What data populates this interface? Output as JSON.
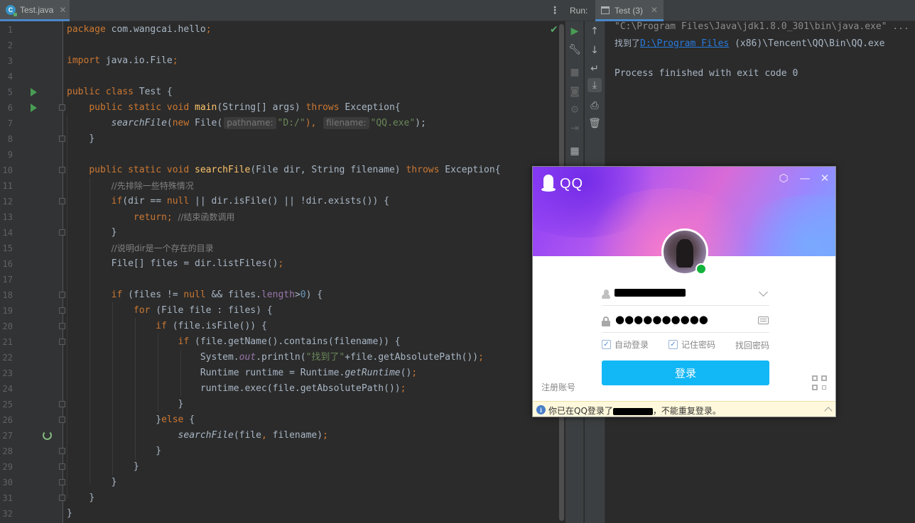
{
  "editor": {
    "tab_label": "Test.java",
    "tab_icon": "java-class-icon",
    "lines": {
      "n1": "1",
      "n2": "2",
      "n3": "3",
      "n4": "4",
      "n5": "5",
      "n6": "6",
      "n7": "7",
      "n8": "8",
      "n9": "9",
      "n10": "10",
      "n11": "11",
      "n12": "12",
      "n13": "13",
      "n14": "14",
      "n15": "15",
      "n16": "16",
      "n17": "17",
      "n18": "18",
      "n19": "19",
      "n20": "20",
      "n21": "21",
      "n22": "22",
      "n23": "23",
      "n24": "24",
      "n25": "25",
      "n26": "26",
      "n27": "27",
      "n28": "28",
      "n29": "29",
      "n30": "30",
      "n31": "31",
      "n32": "32"
    },
    "code": {
      "l1_kw": "package",
      "l1_txt": " com.wangcai.hello",
      "l1_semi": ";",
      "l3_kw": "import",
      "l3_txt": " java.io.File",
      "l3_semi": ";",
      "l5_kw": "public class",
      "l5_txt": " Test {",
      "l6_kw1": "public static void",
      "l6_fn": "main",
      "l6_txt1": "(String[] args) ",
      "l6_kw2": "throws",
      "l6_txt2": " Exception{",
      "l7_fn": "searchFile",
      "l7_p1": "(",
      "l7_new": "new",
      "l7_cls": " File(",
      "l7_hint1": "pathname:",
      "l7_str1": "\"D:/\"",
      "l7_p2": "),",
      "l7_hint2": "filename:",
      "l7_str2": "\"QQ.exe\"",
      "l7_p3": ");",
      "l8": "}",
      "l10_kw1": "public static void",
      "l10_fn": "searchFile",
      "l10_txt1": "(File dir, String filename) ",
      "l10_kw2": "throws",
      "l10_txt2": " Exception{",
      "l11_cm": "//先排除一些特殊情况",
      "l12_kw": "if",
      "l12_t1": "(dir == ",
      "l12_null": "null",
      "l12_t2": " || dir.isFile() || !dir.exists()) {",
      "l13_kw": "return;",
      "l13_cm": "  //结束函数调用",
      "l14": "}",
      "l15_cm": "//说明dir是一个存在的目录",
      "l16_txt": "File[] files = dir.listFiles()",
      "l16_semi": ";",
      "l18_kw": "if",
      "l18_t1": " (files != ",
      "l18_null": "null",
      "l18_t2": " && files.",
      "l18_fld": "length",
      "l18_t3": ">",
      "l18_num": "0",
      "l18_t4": ") {",
      "l19_kw": "for",
      "l19_txt": " (File file : files) {",
      "l20_kw": "if",
      "l20_txt": " (file.isFile()) {",
      "l21_kw": "if",
      "l21_txt": " (file.getName().contains(filename)) {",
      "l22_t1": "System.",
      "l22_out": "out",
      "l22_t2": ".println(",
      "l22_str": "\"找到了\"",
      "l22_t3": "+file.getAbsolutePath())",
      "l22_semi": ";",
      "l23_t1": "Runtime runtime = Runtime.",
      "l23_fn": "getRuntime",
      "l23_t2": "()",
      "l23_semi": ";",
      "l24_t1": "runtime.exec(file.getAbsolutePath())",
      "l24_semi": ";",
      "l25": "}",
      "l26_t1": "}",
      "l26_kw": "else",
      "l26_t2": " {",
      "l27_fn": "searchFile",
      "l27_t1": "(file",
      "l27_comma": ",",
      "l27_t2": " filename)",
      "l27_semi": ";",
      "l28": "}",
      "l29": "}",
      "l30": "}",
      "l31": "}",
      "l32": "}"
    }
  },
  "run_panel": {
    "label": "Run:",
    "tab_label": "Test (3)",
    "console": {
      "line1": "\"C:\\Program Files\\Java\\jdk1.8.0_301\\bin\\java.exe\" ...",
      "line2_prefix": "找到了",
      "line2_link": "D:\\Program Files",
      "line2_rest": " (x86)\\Tencent\\QQ\\Bin\\QQ.exe",
      "line3": "Process finished with exit code 0"
    }
  },
  "qq": {
    "title": "QQ",
    "password_mask": "●●●●●●●●●●",
    "auto_login": "自动登录",
    "remember_password": "记住密码",
    "retrieve_password": "找回密码",
    "login_button": "登录",
    "register": "注册账号",
    "notice_prefix": "你已在QQ登录了",
    "notice_suffix": "，不能重复登录。"
  },
  "colors": {
    "editor_bg": "#2b2b2b",
    "keyword": "#cc7832",
    "function": "#ffc66d",
    "string": "#6a8759",
    "comment": "#808080",
    "qq_login_button": "#12b7f5",
    "link": "#287bde"
  }
}
